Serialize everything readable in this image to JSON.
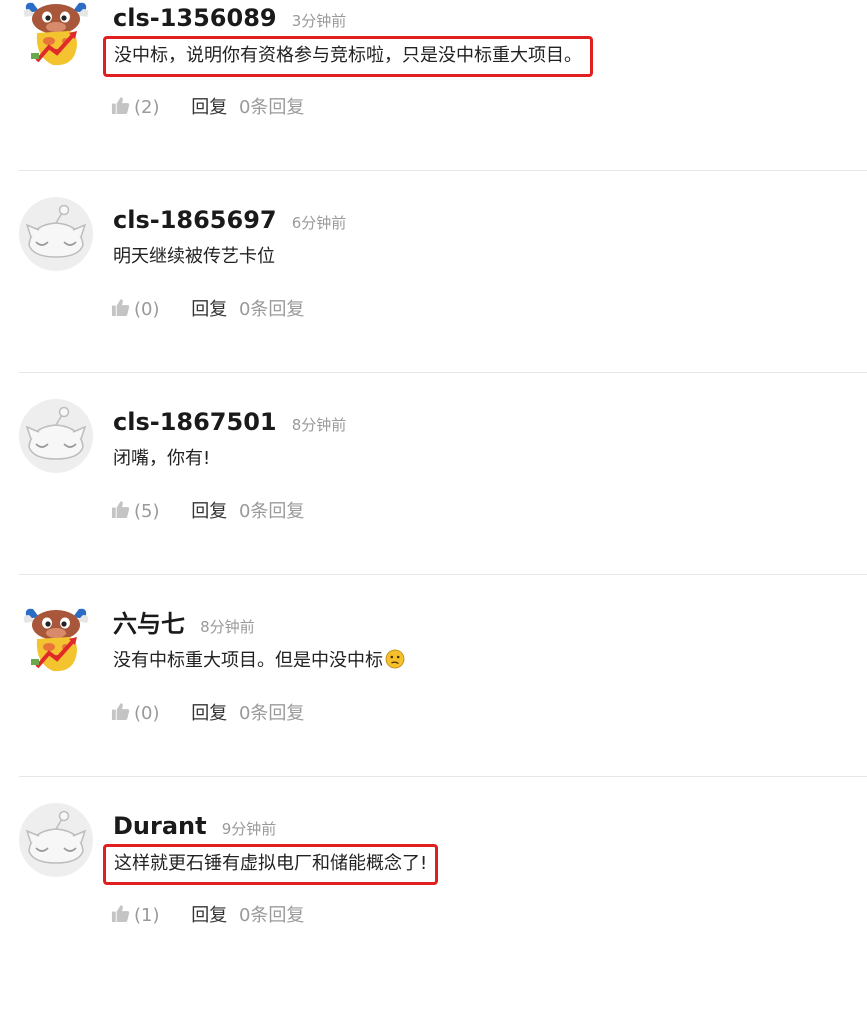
{
  "comments": [
    {
      "username": "cls-1356089",
      "time": "3分钟前",
      "avatar_icon": "bull-mascot-icon",
      "content": "没中标，说明你有资格参与竞标啦，只是没中标重大项目。",
      "highlighted": true,
      "likes": "(2)",
      "reply_label": "回复",
      "reply_count": "0条回复"
    },
    {
      "username": "cls-1865697",
      "time": "6分钟前",
      "avatar_icon": "default-face-avatar-icon",
      "content": "明天继续被传艺卡位",
      "highlighted": false,
      "likes": "(0)",
      "reply_label": "回复",
      "reply_count": "0条回复"
    },
    {
      "username": "cls-1867501",
      "time": "8分钟前",
      "avatar_icon": "default-face-avatar-icon",
      "content": "闭嘴，你有!",
      "highlighted": false,
      "likes": "(5)",
      "reply_label": "回复",
      "reply_count": "0条回复"
    },
    {
      "username": "六与七",
      "time": "8分钟前",
      "avatar_icon": "bull-mascot-icon",
      "content": "没有中标重大项目。但是中没中标",
      "content_emoji": "confused-face-emoji",
      "highlighted": false,
      "likes": "(0)",
      "reply_label": "回复",
      "reply_count": "0条回复"
    },
    {
      "username": "Durant",
      "time": "9分钟前",
      "avatar_icon": "default-face-avatar-icon",
      "content": "这样就更石锤有虚拟电厂和储能概念了!",
      "highlighted": true,
      "likes": "(1)",
      "reply_label": "回复",
      "reply_count": "0条回复"
    }
  ],
  "colors": {
    "highlight_border": "#e02020",
    "muted_text": "#9a9a9a",
    "divider": "#e6e6e6"
  }
}
